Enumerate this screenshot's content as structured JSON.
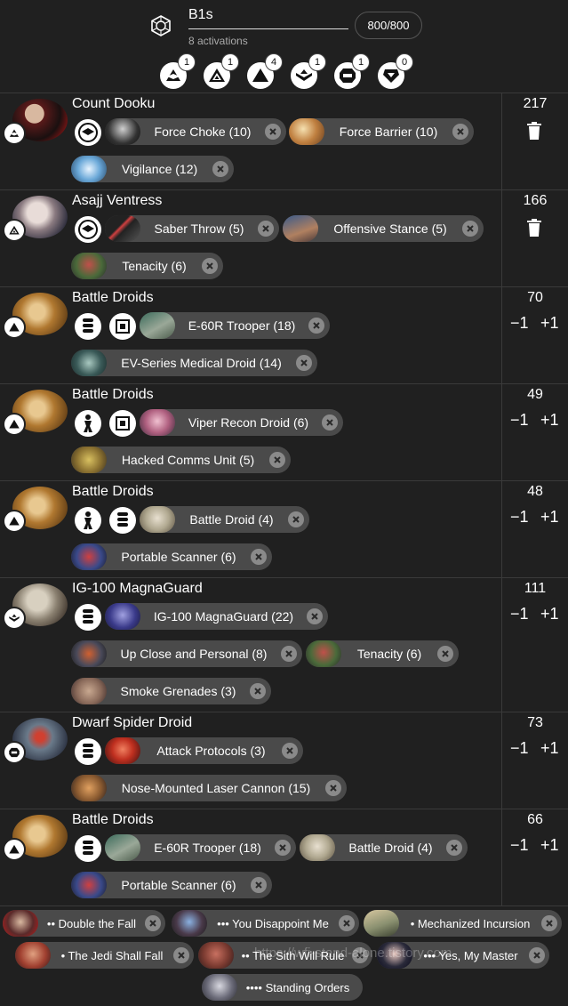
{
  "header": {
    "faction_icon": "separatist-hexagon-icon",
    "army_name": "B1s",
    "activations": "8 activations",
    "points": "800/800",
    "ranks": [
      {
        "icon": "commander-rank-icon",
        "count": "1"
      },
      {
        "icon": "operative-rank-icon",
        "count": "1"
      },
      {
        "icon": "corps-rank-icon",
        "count": "4"
      },
      {
        "icon": "special-forces-rank-icon",
        "count": "1"
      },
      {
        "icon": "support-rank-icon",
        "count": "1"
      },
      {
        "icon": "heavy-rank-icon",
        "count": "0"
      }
    ]
  },
  "units": [
    {
      "name": "Count Dooku",
      "points": "217",
      "control": "trash",
      "upgrades": [
        "Force Choke (10)",
        "Force Barrier (10)",
        "Vigilance (12)"
      ]
    },
    {
      "name": "Asajj Ventress",
      "points": "166",
      "control": "trash",
      "upgrades": [
        "Saber Throw (5)",
        "Offensive Stance (5)",
        "Tenacity (6)"
      ]
    },
    {
      "name": "Battle Droids",
      "points": "70",
      "control": "stepper",
      "upgrades": [
        "E-60R Trooper (18)",
        "EV-Series Medical Droid (14)"
      ]
    },
    {
      "name": "Battle Droids",
      "points": "49",
      "control": "stepper",
      "upgrades": [
        "Viper Recon Droid (6)",
        "Hacked Comms Unit (5)"
      ]
    },
    {
      "name": "Battle Droids",
      "points": "48",
      "control": "stepper",
      "upgrades": [
        "Battle Droid (4)",
        "Portable Scanner (6)"
      ]
    },
    {
      "name": "IG-100 MagnaGuard",
      "points": "111",
      "control": "stepper",
      "upgrades": [
        "IG-100 MagnaGuard (22)",
        "Up Close and Personal (8)",
        "Tenacity (6)",
        "Smoke Grenades (3)"
      ]
    },
    {
      "name": "Dwarf Spider Droid",
      "points": "73",
      "control": "stepper",
      "upgrades": [
        "Attack Protocols (3)",
        "Nose-Mounted Laser Cannon (15)"
      ]
    },
    {
      "name": "Battle Droids",
      "points": "66",
      "control": "stepper",
      "upgrades": [
        "E-60R Trooper (18)",
        "Battle Droid (4)",
        "Portable Scanner (6)"
      ]
    }
  ],
  "stepper": {
    "minus": "−1",
    "plus": "+1"
  },
  "command_cards": [
    "•• Double the Fall",
    "••• You Disappoint Me",
    "• Mechanized Incursion",
    "• The Jedi Shall Fall",
    "•• The Sith Will Rule",
    "••• Yes, My Master",
    "•••• Standing Orders"
  ],
  "watermark": "https://wfi-stand-alone.tistory.com",
  "colors": {
    "background": "#202020",
    "chip": "#4a4a4a",
    "chip_close": "#8a8a8a",
    "divider": "#3a3a3a"
  }
}
